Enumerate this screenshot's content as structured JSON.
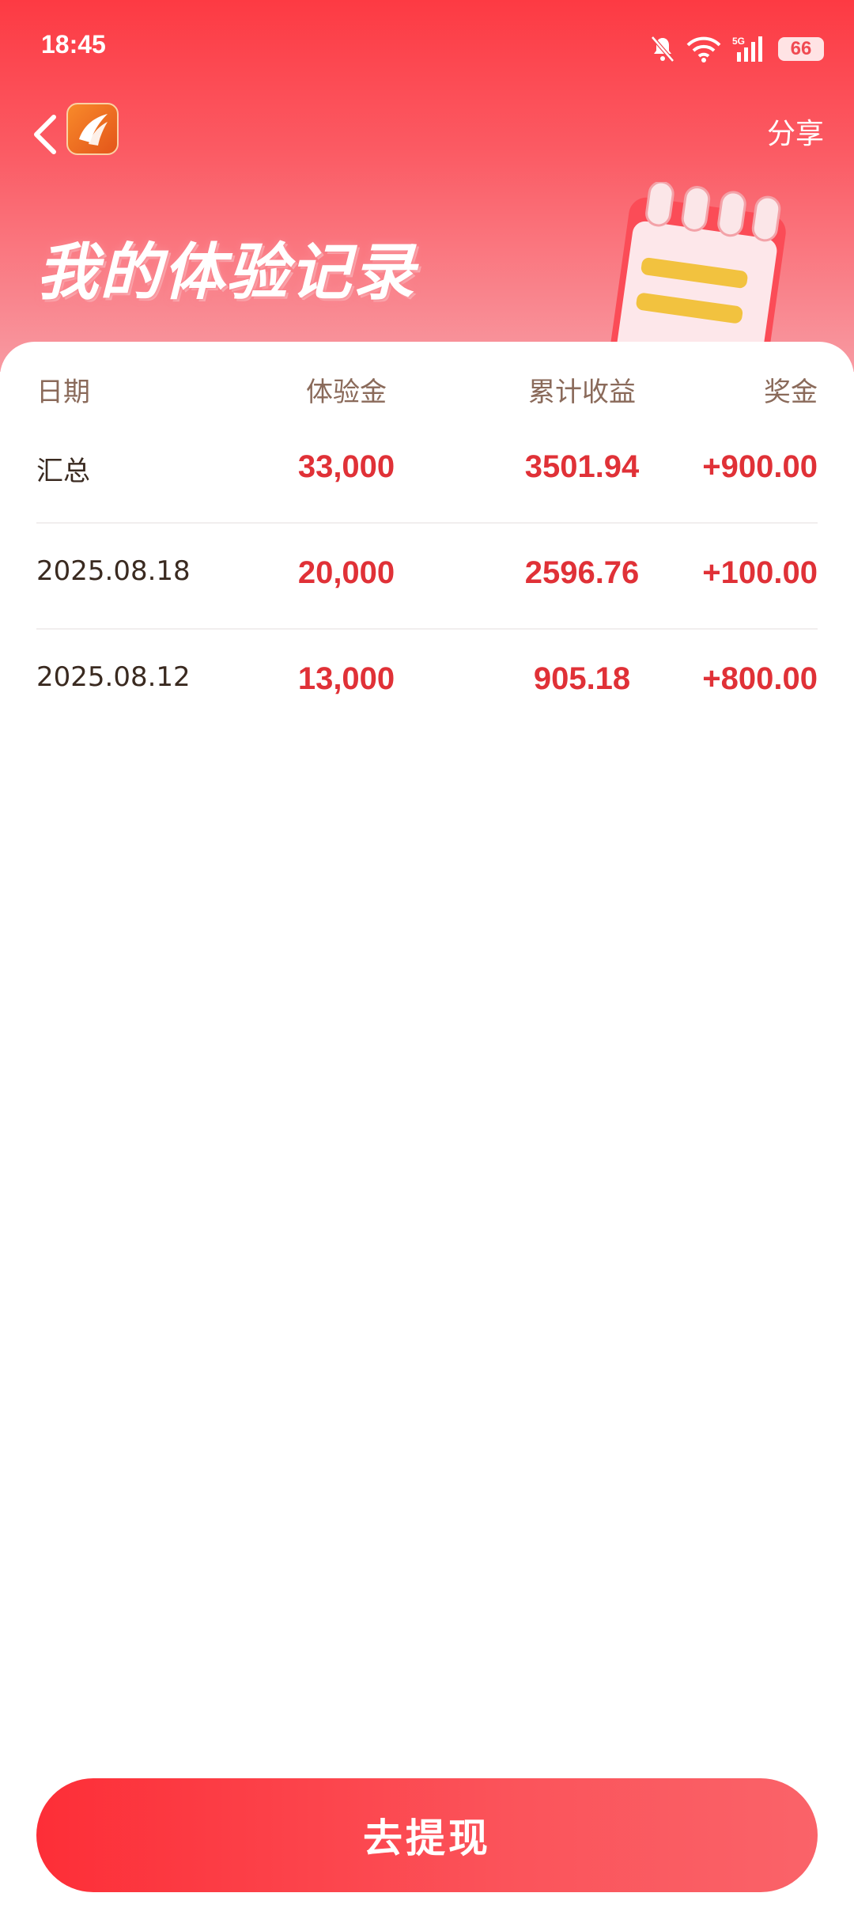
{
  "status_bar": {
    "time": "18:45",
    "battery": "66",
    "network": "5G"
  },
  "nav": {
    "share_label": "分享"
  },
  "hero": {
    "title": "我的体验记录"
  },
  "table": {
    "headers": [
      "日期",
      "体验金",
      "累计收益",
      "奖金"
    ],
    "rows": [
      {
        "date": "汇总",
        "experience": "33,000",
        "profit": "3501.94",
        "bonus": "+900.00"
      },
      {
        "date": "2025.08.18",
        "experience": "20,000",
        "profit": "2596.76",
        "bonus": "+100.00"
      },
      {
        "date": "2025.08.12",
        "experience": "13,000",
        "profit": "905.18",
        "bonus": "+800.00"
      }
    ]
  },
  "cta": {
    "label": "去提现"
  },
  "colors": {
    "accent": "#e03137",
    "hero_top": "#fd3a43",
    "header_text": "#8a6a5a"
  },
  "icons": [
    "back-icon",
    "app-logo-icon",
    "bell-muted-icon",
    "wifi-icon",
    "signal-icon",
    "battery-icon"
  ]
}
